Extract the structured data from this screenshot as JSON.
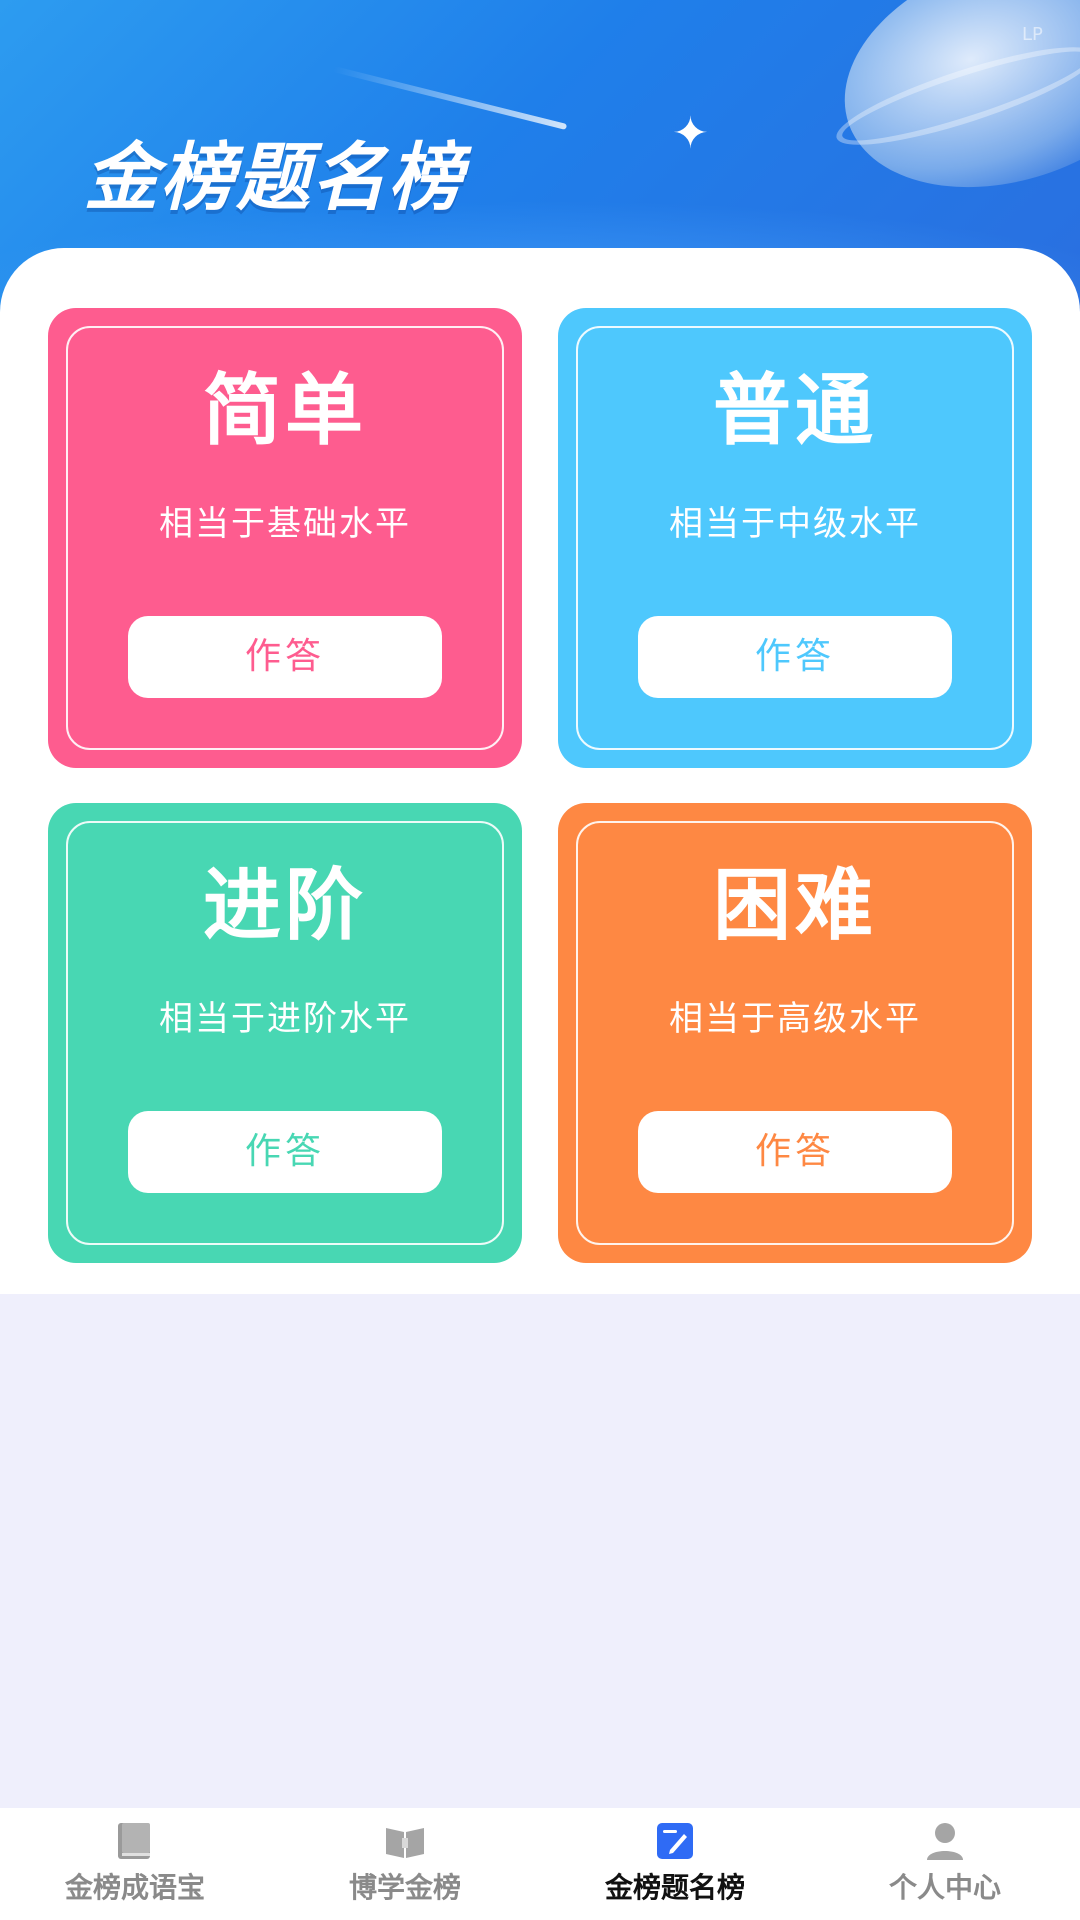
{
  "header": {
    "title": "金榜题名榜",
    "corner_mark": "LP"
  },
  "levels": [
    {
      "title": "简单",
      "desc": "相当于基础水平",
      "button": "作答",
      "color": "#fe5c8f"
    },
    {
      "title": "普通",
      "desc": "相当于中级水平",
      "button": "作答",
      "color": "#4ec8fd"
    },
    {
      "title": "进阶",
      "desc": "相当于进阶水平",
      "button": "作答",
      "color": "#48d7b3"
    },
    {
      "title": "困难",
      "desc": "相当于高级水平",
      "button": "作答",
      "color": "#fe8843"
    }
  ],
  "tabbar": {
    "items": [
      {
        "label": "金榜成语宝",
        "icon": "book-icon",
        "active": false
      },
      {
        "label": "博学金榜",
        "icon": "open-book-icon",
        "active": false
      },
      {
        "label": "金榜题名榜",
        "icon": "edit-icon",
        "active": true
      },
      {
        "label": "个人中心",
        "icon": "person-icon",
        "active": false
      }
    ],
    "active_color": "#2f6bf5",
    "inactive_color": "#8a8a8a"
  }
}
